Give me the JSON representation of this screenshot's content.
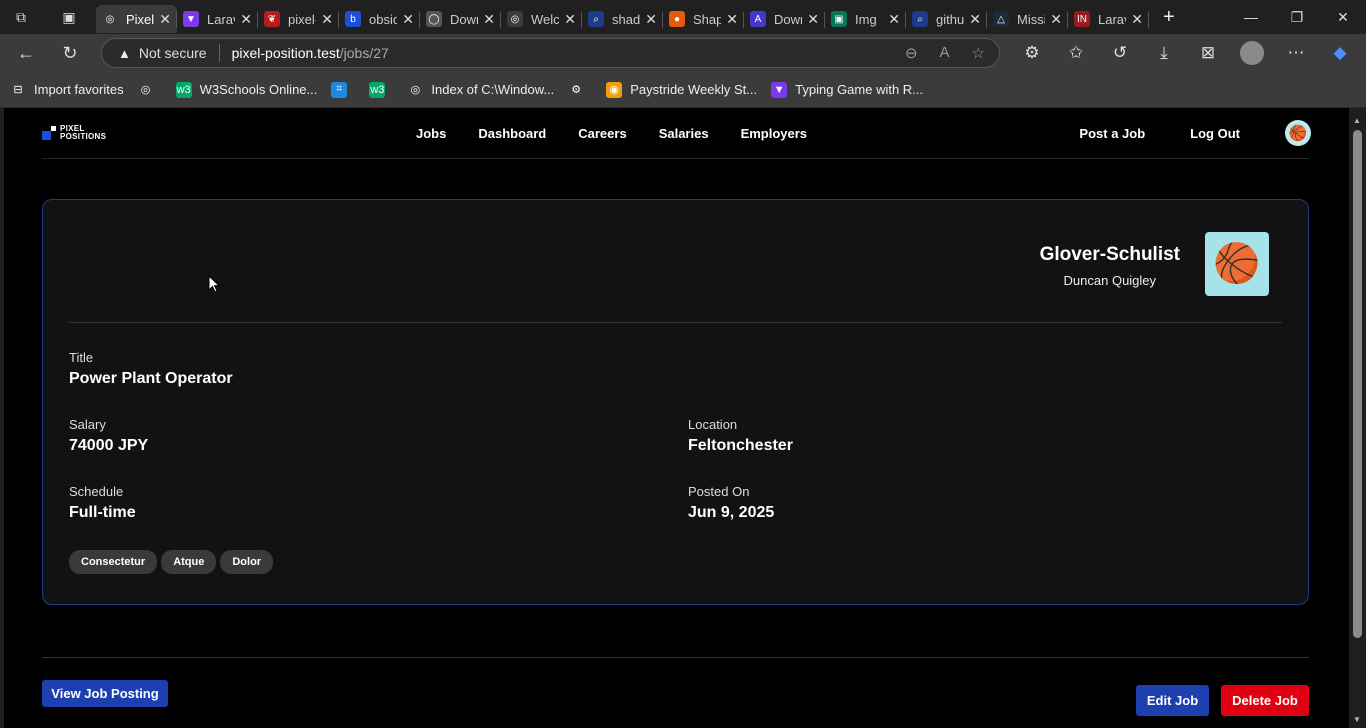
{
  "browser": {
    "tabs": [
      {
        "title": "Pixel Positions",
        "color": "#3b3b3b",
        "glyph": "◎"
      },
      {
        "title": "Laravel",
        "color": "#7c3aed",
        "glyph": "▼"
      },
      {
        "title": "pixel-positions",
        "color": "#b91c1c",
        "glyph": "❦"
      },
      {
        "title": "obsidian",
        "color": "#1d4ed8",
        "glyph": "b"
      },
      {
        "title": "Download",
        "color": "#555555",
        "glyph": "◯"
      },
      {
        "title": "Welcome",
        "color": "#3b3b3b",
        "glyph": "◎"
      },
      {
        "title": "shadcn",
        "color": "#1e3a8a",
        "glyph": "⌕"
      },
      {
        "title": "Shape",
        "color": "#ea580c",
        "glyph": "●"
      },
      {
        "title": "Download",
        "color": "#4338ca",
        "glyph": "A"
      },
      {
        "title": "Img",
        "color": "#047857",
        "glyph": "▣"
      },
      {
        "title": "github",
        "color": "#1e3a8a",
        "glyph": "⌕"
      },
      {
        "title": "Missing",
        "color": "#1e293b",
        "glyph": "△"
      },
      {
        "title": "Laravel",
        "color": "#991b1b",
        "glyph": "IN"
      }
    ],
    "address": {
      "warning": "Not secure",
      "host": "pixel-position.test",
      "path": "/jobs/27"
    },
    "bookmarks": [
      {
        "label": "Import favorites",
        "glyph": "⊟",
        "color": "transparent"
      },
      {
        "label": "",
        "glyph": "◎",
        "color": "transparent"
      },
      {
        "label": "W3Schools Online...",
        "glyph": "w3",
        "color": "#04aa6d"
      },
      {
        "label": "",
        "glyph": "⌗",
        "color": "#1e88e5"
      },
      {
        "label": "",
        "glyph": "w3",
        "color": "#04aa6d"
      },
      {
        "label": "Index of C:\\Window...",
        "glyph": "◎",
        "color": "transparent"
      },
      {
        "label": "",
        "glyph": "⚙",
        "color": "transparent"
      },
      {
        "label": "Paystride Weekly St...",
        "glyph": "◉",
        "color": "#f59e0b"
      },
      {
        "label": "Typing Game with R...",
        "glyph": "▼",
        "color": "#7c3aed"
      }
    ]
  },
  "site": {
    "logo_line1": "PIXEL",
    "logo_line2": "POSITIONS",
    "nav": [
      "Jobs",
      "Dashboard",
      "Careers",
      "Salaries",
      "Employers"
    ],
    "post_job": "Post a Job",
    "log_out": "Log Out",
    "avatar_glyph": "🏀"
  },
  "job": {
    "employer": "Glover-Schulist",
    "person": "Duncan Quigley",
    "employer_logo": "🏀",
    "title_label": "Title",
    "title": "Power Plant Operator",
    "salary_label": "Salary",
    "salary": "74000 JPY",
    "location_label": "Location",
    "location": "Feltonchester",
    "schedule_label": "Schedule",
    "schedule": "Full-time",
    "posted_label": "Posted On",
    "posted": "Jun 9, 2025",
    "tags": [
      "Consectetur",
      "Atque",
      "Dolor"
    ]
  },
  "actions": {
    "view": "View Job Posting",
    "edit": "Edit Job",
    "delete": "Delete Job"
  },
  "colors": {
    "blue": "#1e40af",
    "red": "#e00012",
    "card_border": "#1e3a8a"
  }
}
